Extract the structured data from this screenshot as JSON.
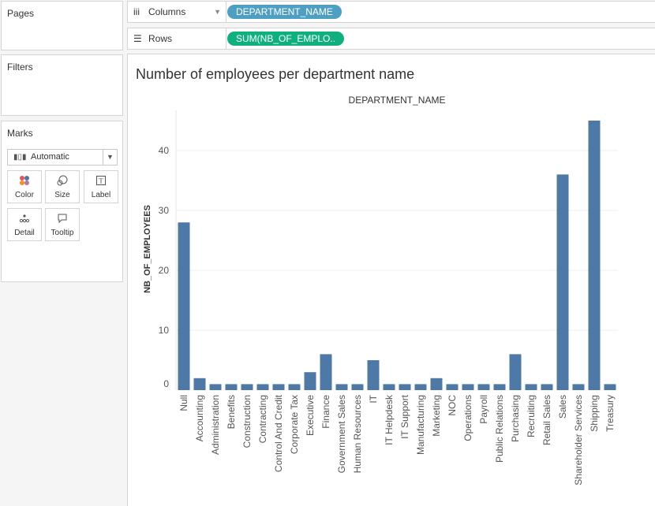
{
  "panels": {
    "pages": "Pages",
    "filters": "Filters",
    "marks": "Marks"
  },
  "shelves": {
    "columns": {
      "label": "Columns",
      "pill": "DEPARTMENT_NAME",
      "pill_color": "#4e9fc1"
    },
    "rows": {
      "label": "Rows",
      "pill": "SUM(NB_OF_EMPLO..",
      "pill_color": "#10b07e"
    }
  },
  "marks": {
    "type": "Automatic",
    "buttons": [
      {
        "label": "Color",
        "icon": "color-dots-icon"
      },
      {
        "label": "Size",
        "icon": "size-icon"
      },
      {
        "label": "Label",
        "icon": "label-icon"
      },
      {
        "label": "Detail",
        "icon": "detail-icon"
      },
      {
        "label": "Tooltip",
        "icon": "tooltip-icon"
      }
    ]
  },
  "chart_data": {
    "type": "bar",
    "title": "Number of employees per department name",
    "xlabel": "DEPARTMENT_NAME",
    "ylabel": "NB_OF_EMPLOYEES",
    "ylim": [
      0,
      45
    ],
    "yticks": [
      0,
      10,
      20,
      30,
      40
    ],
    "grid": true,
    "bar_color": "#4e79a7",
    "categories": [
      "Null",
      "Accounting",
      "Administration",
      "Benefits",
      "Construction",
      "Contracting",
      "Control And Credit",
      "Corporate Tax",
      "Executive",
      "Finance",
      "Government Sales",
      "Human Resources",
      "IT",
      "IT Helpdesk",
      "IT Support",
      "Manufacturing",
      "Marketing",
      "NOC",
      "Operations",
      "Payroll",
      "Public Relations",
      "Purchasing",
      "Recruiting",
      "Retail Sales",
      "Sales",
      "Shareholder Services",
      "Shipping",
      "Treasury"
    ],
    "values": [
      28,
      2,
      1,
      1,
      1,
      1,
      1,
      1,
      3,
      6,
      1,
      1,
      5,
      1,
      1,
      1,
      2,
      1,
      1,
      1,
      1,
      6,
      1,
      1,
      36,
      1,
      45,
      1
    ]
  }
}
